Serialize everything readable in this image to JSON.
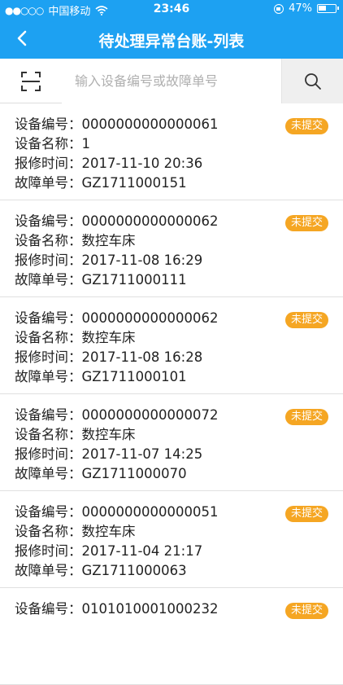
{
  "status_bar": {
    "signal": "●●○○○",
    "carrier": "中国移动",
    "time": "23:46",
    "battery": "47%",
    "battery_level": 0.47
  },
  "nav": {
    "title": "待处理异常台账-列表"
  },
  "search": {
    "placeholder": "输入设备编号或故障单号"
  },
  "labels": {
    "device_no": "设备编号：",
    "device_name": "设备名称：",
    "report_time": "报修时间：",
    "fault_no": "故障单号："
  },
  "items": [
    {
      "device_no": "0000000000000061",
      "device_name": "1",
      "report_time": "2017-11-10 20:36",
      "fault_no": "GZ1711000151",
      "status": "未提交"
    },
    {
      "device_no": "0000000000000062",
      "device_name": "数控车床",
      "report_time": "2017-11-08 16:29",
      "fault_no": "GZ1711000111",
      "status": "未提交"
    },
    {
      "device_no": "0000000000000062",
      "device_name": "数控车床",
      "report_time": "2017-11-08 16:28",
      "fault_no": "GZ1711000101",
      "status": "未提交"
    },
    {
      "device_no": "0000000000000072",
      "device_name": "数控车床",
      "report_time": "2017-11-07 14:25",
      "fault_no": "GZ1711000070",
      "status": "未提交"
    },
    {
      "device_no": "0000000000000051",
      "device_name": "数控车床",
      "report_time": "2017-11-04 21:17",
      "fault_no": "GZ1711000063",
      "status": "未提交"
    },
    {
      "device_no": "0101010001000232",
      "device_name": "",
      "report_time": "",
      "fault_no": "",
      "status": "未提交"
    }
  ],
  "colors": {
    "header": "#1da1f2",
    "badge": "#f5a623"
  },
  "icons": {
    "back": "chevron-left-icon",
    "scan": "scan-icon",
    "search": "search-icon"
  }
}
